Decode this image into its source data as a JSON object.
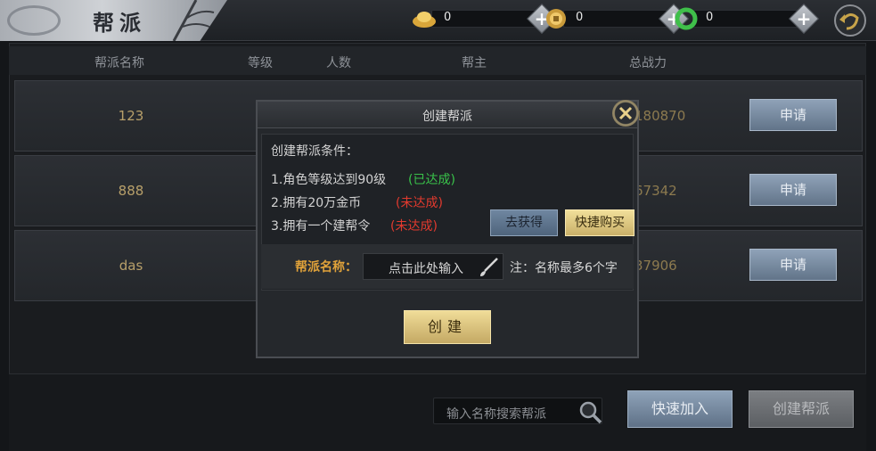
{
  "header": {
    "title": "帮派"
  },
  "resources": [
    {
      "name": "gold-ingot-icon",
      "value": "0"
    },
    {
      "name": "coin-icon",
      "value": "0"
    },
    {
      "name": "jade-icon",
      "value": "0"
    }
  ],
  "table": {
    "columns": [
      "帮派名称",
      "等级",
      "人数",
      "帮主",
      "总战力"
    ],
    "rows": [
      {
        "name": "123",
        "power": "180870"
      },
      {
        "name": "888",
        "power": "67342"
      },
      {
        "name": "das",
        "power": "37906"
      }
    ],
    "apply_label": "申请"
  },
  "bottom": {
    "search_placeholder": "输入名称搜索帮派",
    "quick_join": "快速加入",
    "create_guild": "创建帮派"
  },
  "modal": {
    "title": "创建帮派",
    "conditions_title": "创建帮派条件：",
    "conditions": [
      {
        "text": "1.角色等级达到90级",
        "status": "(已达成)"
      },
      {
        "text": "2.拥有20万金币",
        "status": "(未达成)"
      },
      {
        "text": "3.拥有一个建帮令",
        "status": "(未达成)"
      }
    ],
    "go_get": "去获得",
    "quick_buy": "快捷购买",
    "name_label": "帮派名称：",
    "name_input": "点击此处输入",
    "name_hint": "注：名称最多6个字",
    "create": "创建"
  },
  "colors": {
    "achieved": "#39c24a",
    "not_achieved": "#e23a2e",
    "accent_gold": "#e0a23a"
  }
}
